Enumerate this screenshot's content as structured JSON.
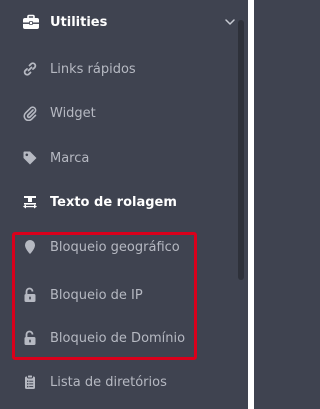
{
  "colors": {
    "sidebar_bg": "#3f4350",
    "text_muted": "#b6b9c2",
    "text_active": "#ffffff",
    "highlight": "#d9001b"
  },
  "header": {
    "label": "Utilities",
    "icon": "toolbox-icon",
    "chevron": "chevron-down-icon"
  },
  "items": [
    {
      "label": "Links rápidos",
      "icon": "link-icon"
    },
    {
      "label": "Widget",
      "icon": "paperclip-icon"
    },
    {
      "label": "Marca",
      "icon": "tag-icon"
    },
    {
      "label": "Texto de rolagem",
      "icon": "scroll-text-icon"
    },
    {
      "label": "Bloqueio geográfico",
      "icon": "map-marker-icon"
    },
    {
      "label": "Bloqueio de IP",
      "icon": "unlock-icon"
    },
    {
      "label": "Bloqueio de Domínio",
      "icon": "unlock-icon"
    },
    {
      "label": "Lista de diretórios",
      "icon": "clipboard-icon"
    }
  ]
}
